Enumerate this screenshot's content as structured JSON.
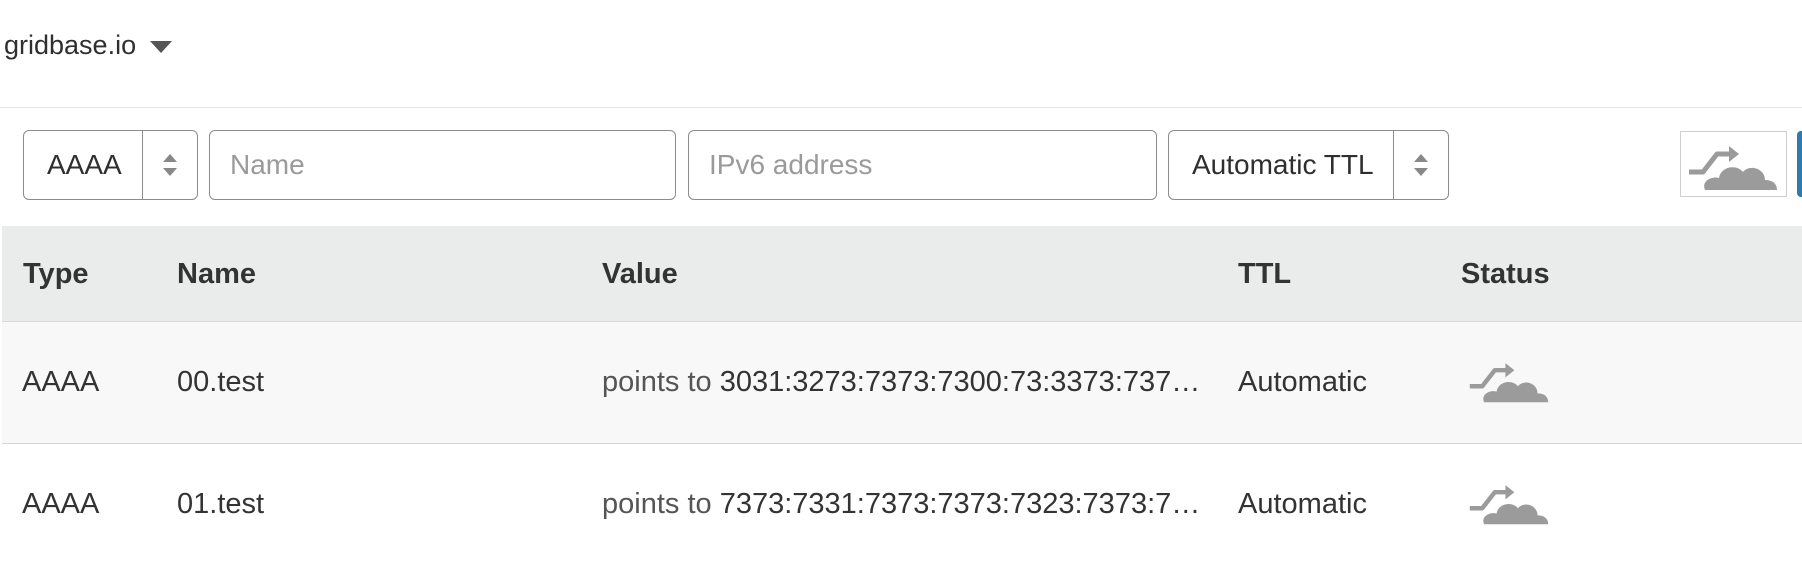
{
  "header": {
    "zone_name": "gridbase.io"
  },
  "form": {
    "type_value": "AAAA",
    "name_placeholder": "Name",
    "value_placeholder": "IPv6 address",
    "ttl_value": "Automatic TTL"
  },
  "table": {
    "columns": [
      "Type",
      "Name",
      "Value",
      "TTL",
      "Status"
    ],
    "rows": [
      {
        "type": "AAAA",
        "name": "00.test",
        "value_prefix": "points to",
        "value": "3031:3273:7373:7300:73:3373:737…",
        "ttl": "Automatic",
        "status_icon": "proxied-cloud-icon"
      },
      {
        "type": "AAAA",
        "name": "01.test",
        "value_prefix": "points to",
        "value": "7373:7331:7373:7373:7323:7373:7…",
        "ttl": "Automatic",
        "status_icon": "proxied-cloud-icon"
      }
    ]
  },
  "colors": {
    "header_bg": "#eaeceb",
    "row_alt_bg": "#f8f8f8",
    "cloud_gray": "#9b9b9b",
    "accent_blue": "#2c7cb0"
  }
}
